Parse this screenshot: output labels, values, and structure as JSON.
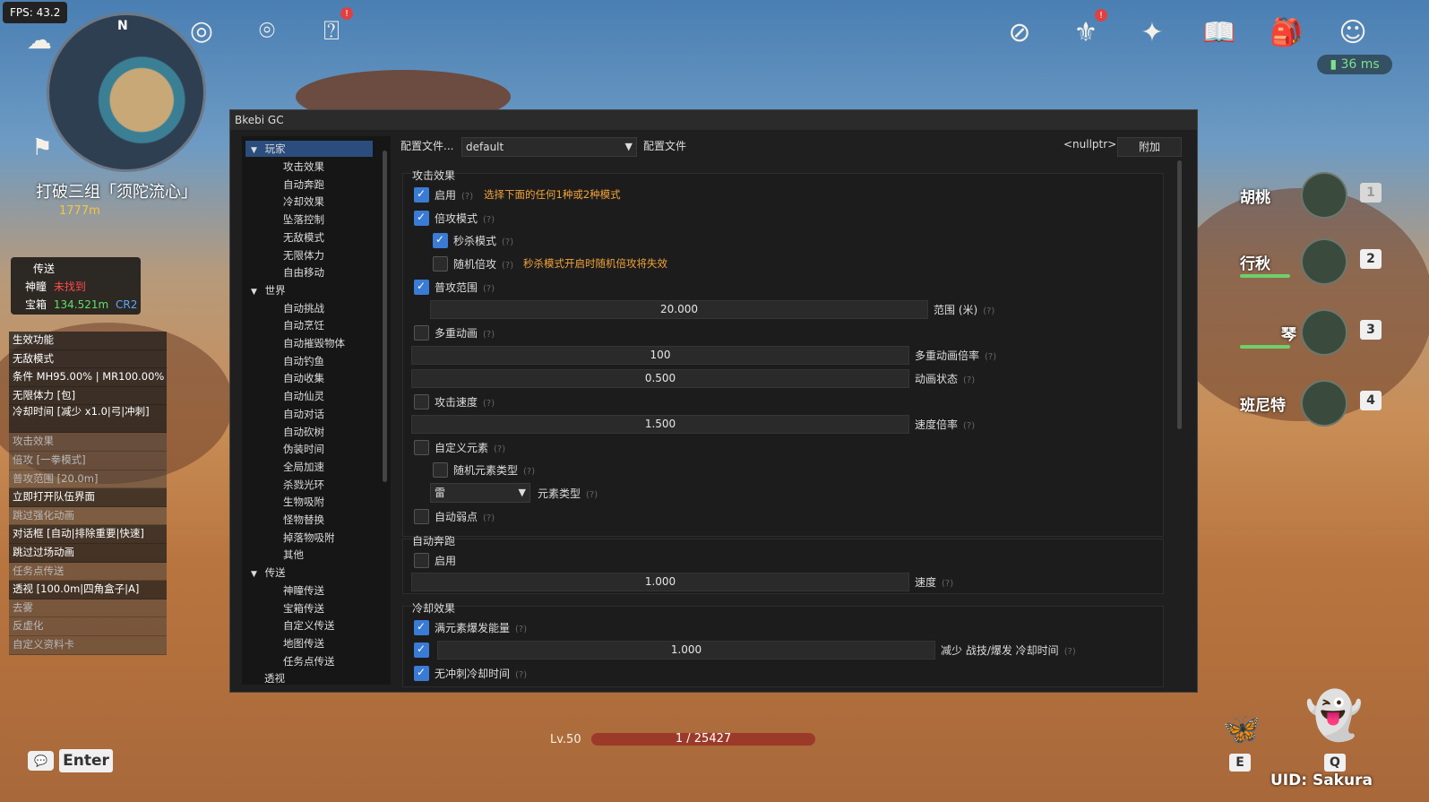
{
  "hud": {
    "fps": "FPS: 43.2",
    "ping": "36 ms",
    "north": "N",
    "quest_title": "打破三组「须陀流心」",
    "quest_distance": "1777m",
    "level": "Lv.50",
    "exp": "1 / 25427",
    "enter_key": "Enter",
    "skill_key": "E",
    "burst_key": "Q",
    "uid": "UID: Sakura",
    "icons": [
      "map-icon",
      "compass-icon",
      "target-icon",
      "quest-icon",
      "gift-icon",
      "wish-icon",
      "starglitter-icon",
      "handbook-icon",
      "inventory-icon",
      "paimon-icon"
    ]
  },
  "teleport_box": {
    "title": "传送",
    "row1_label": "神瞳",
    "row1_value": "未找到",
    "row2_label": "宝箱",
    "row2_value": "134.521m",
    "row2_extra": "CR2"
  },
  "features": {
    "items": [
      "生效功能",
      "无敌模式",
      "条件 MH95.00% | MR100.00%",
      "无限体力 [包]",
      "冷却时间 [减少 x1.0|弓|冲刺]",
      "攻击效果",
      "倍攻 [一拳模式]",
      "普攻范围 [20.0m]",
      "立即打开队伍界面",
      "跳过强化动画",
      "对话框 [自动|排除重要|快速]",
      "跳过过场动画",
      "任务点传送",
      "透视 [100.0m|四角盒子|A]",
      "去雾",
      "反虚化",
      "自定义资料卡"
    ]
  },
  "party": [
    {
      "name": "胡桃",
      "key": "1"
    },
    {
      "name": "行秋",
      "key": "2"
    },
    {
      "name": "琴",
      "key": "3"
    },
    {
      "name": "班尼特",
      "key": "4"
    }
  ],
  "window": {
    "title": "Bkebi GC",
    "tree": {
      "player": "玩家",
      "player_items": [
        "攻击效果",
        "自动奔跑",
        "冷却效果",
        "坠落控制",
        "无敌模式",
        "无限体力",
        "自由移动"
      ],
      "world": "世界",
      "world_items": [
        "自动挑战",
        "自动烹饪",
        "自动摧毁物体",
        "自动钓鱼",
        "自动收集",
        "自动仙灵",
        "自动对话",
        "自动砍树",
        "伪装时间",
        "全局加速",
        "杀戮光环",
        "生物吸附",
        "怪物替换",
        "掉落物吸附",
        "其他"
      ],
      "teleport": "传送",
      "teleport_items": [
        "神瞳传送",
        "宝箱传送",
        "自定义传送",
        "地图传送",
        "任务点传送"
      ],
      "esp": "透视"
    },
    "topbar": {
      "config_button": "配置文件...",
      "config_value": "default",
      "config_label": "配置文件",
      "nullptr": "<nullptr>",
      "attach": "附加"
    },
    "attack": {
      "header": "攻击效果",
      "enable": "启用",
      "enable_hint": "选择下面的任何1种或2种模式",
      "multiplier_mode": "倍攻模式",
      "one_punch": "秒杀模式",
      "random_multiplier": "随机倍攻",
      "random_hint": "秒杀模式开启时随机倍攻将失效",
      "range": "普攻范围",
      "range_value": "20.000",
      "range_label": "范围 (米)",
      "multi_anim": "多重动画",
      "multi_anim_value": "100",
      "multi_anim_label": "多重动画倍率",
      "anim_state_value": "0.500",
      "anim_state_label": "动画状态",
      "attack_speed": "攻击速度",
      "speed_value": "1.500",
      "speed_label": "速度倍率",
      "custom_element": "自定义元素",
      "random_element": "随机元素类型",
      "element_value": "雷",
      "element_label": "元素类型",
      "auto_weak": "自动弱点"
    },
    "auto_run": {
      "header": "自动奔跑",
      "enable": "启用",
      "speed_value": "1.000",
      "speed_label": "速度"
    },
    "cooldown": {
      "header": "冷却效果",
      "full_burst": "满元素爆发能量",
      "reduce_value": "1.000",
      "reduce_label": "减少 战技/爆发 冷却时间",
      "no_dash_cd": "无冲刺冷却时间"
    },
    "help": "(?)"
  }
}
